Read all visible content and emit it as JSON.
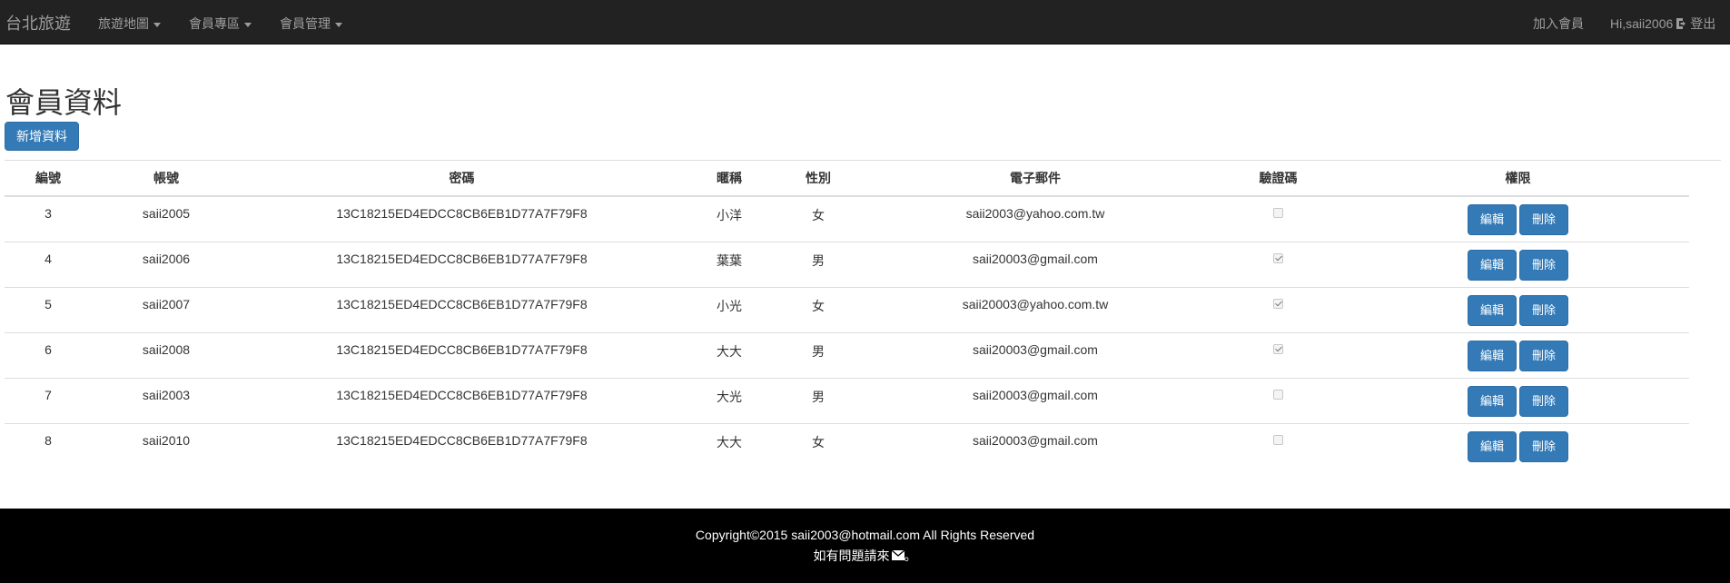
{
  "navbar": {
    "brand": "台北旅遊",
    "menus": [
      "旅遊地圖",
      "會員專區",
      "會員管理"
    ],
    "join": "加入會員",
    "greeting": "Hi,saii2006",
    "logout": "登出"
  },
  "page": {
    "title": "會員資料",
    "add_button": "新增資料"
  },
  "table": {
    "headers": [
      "編號",
      "帳號",
      "密碼",
      "暱稱",
      "性別",
      "電子郵件",
      "驗證碼",
      "權限"
    ],
    "edit_label": "編輯",
    "delete_label": "刪除",
    "rows": [
      {
        "id": "3",
        "account": "saii2005",
        "password": "13C18215ED4EDCC8CB6EB1D77A7F79F8",
        "nickname": "小洋",
        "gender": "女",
        "email": "saii2003@yahoo.com.tw",
        "verified": false
      },
      {
        "id": "4",
        "account": "saii2006",
        "password": "13C18215ED4EDCC8CB6EB1D77A7F79F8",
        "nickname": "葉葉",
        "gender": "男",
        "email": "saii20003@gmail.com",
        "verified": true
      },
      {
        "id": "5",
        "account": "saii2007",
        "password": "13C18215ED4EDCC8CB6EB1D77A7F79F8",
        "nickname": "小光",
        "gender": "女",
        "email": "saii20003@yahoo.com.tw",
        "verified": true
      },
      {
        "id": "6",
        "account": "saii2008",
        "password": "13C18215ED4EDCC8CB6EB1D77A7F79F8",
        "nickname": "大大",
        "gender": "男",
        "email": "saii20003@gmail.com",
        "verified": true
      },
      {
        "id": "7",
        "account": "saii2003",
        "password": "13C18215ED4EDCC8CB6EB1D77A7F79F8",
        "nickname": "大光",
        "gender": "男",
        "email": "saii20003@gmail.com",
        "verified": false
      },
      {
        "id": "8",
        "account": "saii2010",
        "password": "13C18215ED4EDCC8CB6EB1D77A7F79F8",
        "nickname": "大大",
        "gender": "女",
        "email": "saii20003@gmail.com",
        "verified": false
      }
    ]
  },
  "footer": {
    "copyright": "Copyright©2015 saii2003@hotmail.com All Rights Reserved",
    "contact": "如有問題請來",
    "contact_suffix": "。"
  },
  "colors": {
    "navbar_bg": "#222222",
    "primary": "#337ab7",
    "footer_bg": "#000000"
  },
  "icons": {
    "caret": "caret-down-icon",
    "logout": "logout-icon",
    "mail": "mail-icon"
  }
}
